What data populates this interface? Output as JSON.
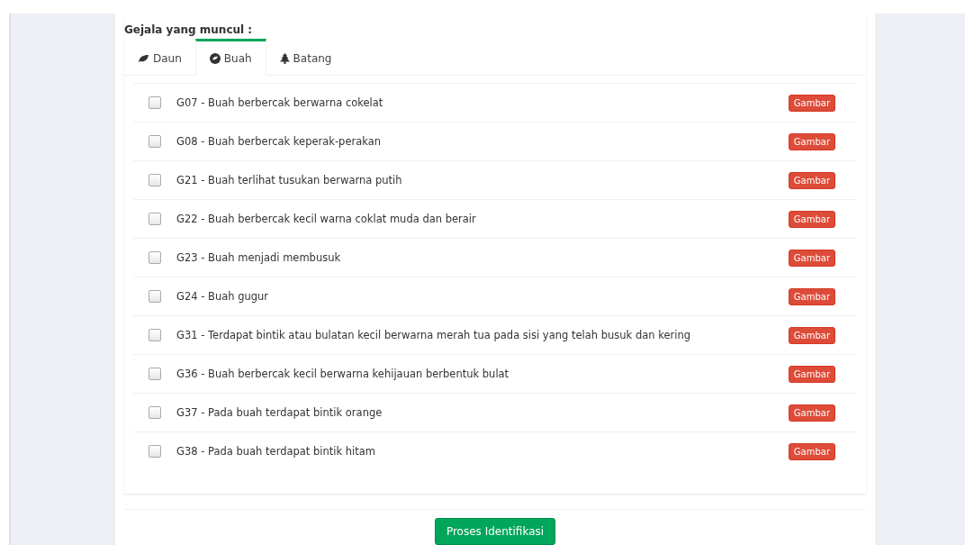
{
  "heading": "Gejala yang muncul :",
  "tabs": [
    {
      "label": "Daun",
      "kind": "leaf",
      "selected": false
    },
    {
      "label": "Buah",
      "kind": "fruit",
      "selected": true
    },
    {
      "label": "Batang",
      "kind": "tree",
      "selected": false
    }
  ],
  "symptoms": [
    {
      "label": "G07 - Buah berbercak berwarna cokelat",
      "checked": false,
      "button": "Gambar"
    },
    {
      "label": "G08 - Buah berbercak keperak-perakan",
      "checked": false,
      "button": "Gambar"
    },
    {
      "label": "G21 - Buah terlihat tusukan berwarna putih",
      "checked": false,
      "button": "Gambar"
    },
    {
      "label": "G22 - Buah berbercak kecil warna coklat muda dan berair",
      "checked": false,
      "button": "Gambar"
    },
    {
      "label": "G23 - Buah menjadi membusuk",
      "checked": false,
      "button": "Gambar"
    },
    {
      "label": "G24 - Buah gugur",
      "checked": false,
      "button": "Gambar"
    },
    {
      "label": "G31 - Terdapat bintik atau bulatan kecil berwarna merah tua pada sisi yang telah busuk dan kering",
      "checked": false,
      "button": "Gambar"
    },
    {
      "label": "G36 - Buah berbercak kecil berwarna kehijauan berbentuk bulat",
      "checked": false,
      "button": "Gambar"
    },
    {
      "label": "G37 - Pada buah terdapat bintik orange",
      "checked": false,
      "button": "Gambar"
    },
    {
      "label": "G38 - Pada buah terdapat bintik hitam",
      "checked": false,
      "button": "Gambar"
    }
  ],
  "submit": "Proses Identifikasi"
}
